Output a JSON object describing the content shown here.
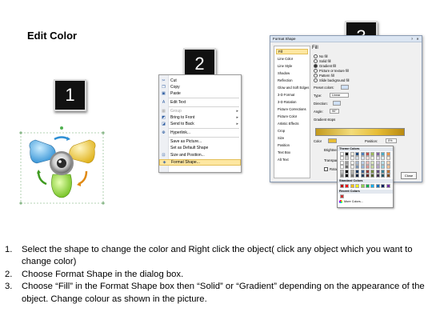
{
  "title": "Edit Color",
  "badges": [
    "1",
    "2",
    "3"
  ],
  "context_menu": {
    "items": [
      {
        "label": "Cut",
        "icon": "scissors-icon",
        "submenu": false,
        "disabled": false
      },
      {
        "label": "Copy",
        "icon": "copy-icon",
        "submenu": false,
        "disabled": false
      },
      {
        "label": "Paste",
        "icon": "paste-icon",
        "submenu": false,
        "disabled": false
      },
      {
        "label": "Edit Text",
        "icon": "edit-text-icon",
        "submenu": false,
        "disabled": false
      },
      {
        "label": "Group",
        "icon": "group-icon",
        "submenu": true,
        "disabled": true
      },
      {
        "label": "Bring to Front",
        "icon": "bring-front-icon",
        "submenu": true,
        "disabled": false
      },
      {
        "label": "Send to Back",
        "icon": "send-back-icon",
        "submenu": true,
        "disabled": false
      },
      {
        "label": "Hyperlink...",
        "icon": "hyperlink-icon",
        "submenu": false,
        "disabled": false
      },
      {
        "label": "Save as Picture...",
        "icon": "",
        "submenu": false,
        "disabled": false
      },
      {
        "label": "Set as Default Shape",
        "icon": "",
        "submenu": false,
        "disabled": false
      },
      {
        "label": "Size and Position...",
        "icon": "size-position-icon",
        "submenu": false,
        "disabled": false
      },
      {
        "label": "Format Shape...",
        "icon": "format-shape-icon",
        "submenu": false,
        "disabled": false,
        "highlighted": true
      }
    ]
  },
  "dialog": {
    "title": "Format Shape",
    "nav_items": [
      "Fill",
      "Line Color",
      "Line Style",
      "Shadow",
      "Reflection",
      "Glow and Soft Edges",
      "3-D Format",
      "3-D Rotation",
      "Picture Corrections",
      "Picture Color",
      "Artistic Effects",
      "Crop",
      "Size",
      "Position",
      "Text Box",
      "Alt Text"
    ],
    "selected_nav": "Fill",
    "fill_heading": "Fill",
    "fill_options": [
      {
        "label": "No fill",
        "selected": false
      },
      {
        "label": "Solid fill",
        "selected": false
      },
      {
        "label": "Gradient fill",
        "selected": true
      },
      {
        "label": "Picture or texture fill",
        "selected": false
      },
      {
        "label": "Pattern fill",
        "selected": false
      },
      {
        "label": "Slide background fill",
        "selected": false
      }
    ],
    "preset_colors_label": "Preset colors:",
    "type_label": "Type:",
    "type_value": "Linear",
    "direction_label": "Direction:",
    "angle_label": "Angle:",
    "angle_value": "90°",
    "gradient_stops_label": "Gradient stops",
    "color_label": "Color",
    "position_label": "Position:",
    "position_value": "0%",
    "brightness_label": "Brightness:",
    "transparency_label": "Transparency:",
    "rotate_label": "Rotate with shape",
    "close_label": "Close"
  },
  "palette": {
    "theme_label": "Theme Colors",
    "standard_label": "Standard Colors",
    "recent_label": "Recent Colors",
    "more_label": "More Colors...",
    "theme_top": [
      "#ffffff",
      "#000000",
      "#eeece1",
      "#1f497d",
      "#4f81bd",
      "#c0504d",
      "#9bbb59",
      "#8064a2",
      "#4bacc6",
      "#f79646"
    ],
    "standard": [
      "#c00000",
      "#ff0000",
      "#ffc000",
      "#ffff00",
      "#92d050",
      "#00b050",
      "#00b0f0",
      "#0070c0",
      "#002060",
      "#7030a0"
    ],
    "recent": [
      "#cc3333"
    ]
  },
  "instructions": [
    {
      "num": "1.",
      "text": "Select the shape to change the color and Right click the object( click any object which you want to change color)"
    },
    {
      "num": "2.",
      "text": "Choose Format Shape in the dialog box."
    },
    {
      "num": "3.",
      "text": "Choose “Fill” in the Format Shape box then “Solid” or “Gradient” depending on the appearance of the object. Change colour as shown in the picture."
    }
  ]
}
